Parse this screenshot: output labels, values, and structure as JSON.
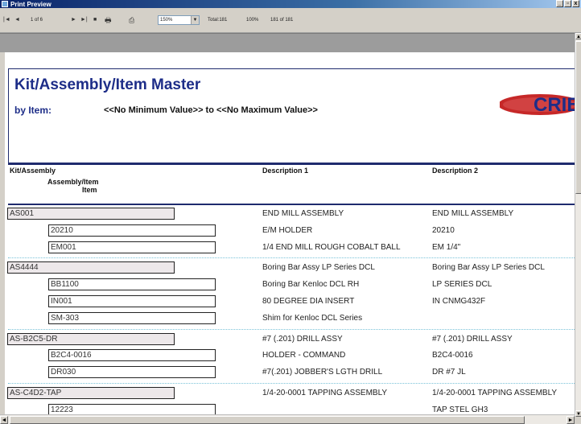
{
  "window": {
    "title": "Print Preview",
    "minimize": "_",
    "maximize": "▫",
    "close": "x"
  },
  "toolbar": {
    "first_page": "|◄",
    "prev_page": "◄",
    "page_indicator": "1 of 6",
    "next_page": "►",
    "last_page": "►|",
    "stop": "■",
    "print": "🖶",
    "export": "⎙",
    "zoom": "150%",
    "zoom_dropdown": "▼",
    "total": "Total:181",
    "percent": "100%",
    "records": "181 of 181"
  },
  "report": {
    "title": "Kit/Assembly/Item Master",
    "by_label": "by Item:",
    "range_text": "<<No Minimum Value>>  to  <<No Maximum Value>>",
    "logo_text": "CRIB",
    "col_kit": "Kit/Assembly",
    "col_assembly_item": "Assembly/Item",
    "col_item": "Item",
    "col_desc1": "Description 1",
    "col_desc2": "Description 2",
    "kits": [
      {
        "code": "AS001",
        "desc1": "END MILL ASSEMBLY",
        "desc2": "END MILL ASSEMBLY",
        "items": [
          {
            "code": "20210",
            "desc1": "E/M HOLDER",
            "desc2": "20210"
          },
          {
            "code": "EM001",
            "desc1": "1/4 END MILL ROUGH COBALT BALL",
            "desc2": "EM 1/4\""
          }
        ]
      },
      {
        "code": "AS4444",
        "desc1": "Boring Bar Assy  LP Series DCL",
        "desc2": "Boring Bar Assy  LP Series DCL",
        "items": [
          {
            "code": "BB1100",
            "desc1": "Boring Bar Kenloc DCL RH",
            "desc2": "LP SERIES DCL"
          },
          {
            "code": "IN001",
            "desc1": "80 DEGREE DIA INSERT",
            "desc2": "IN CNMG432F"
          },
          {
            "code": "SM-303",
            "desc1": "Shim for Kenloc DCL Series",
            "desc2": ""
          }
        ]
      },
      {
        "code": "AS-B2C5-DR",
        "desc1": "#7 (.201) DRILL ASSY",
        "desc2": "#7 (.201) DRILL ASSY",
        "items": [
          {
            "code": "B2C4-0016",
            "desc1": "HOLDER - COMMAND",
            "desc2": "B2C4-0016"
          },
          {
            "code": "DR030",
            "desc1": "#7(.201) JOBBER'S LGTH DRILL",
            "desc2": "DR #7 JL"
          }
        ]
      },
      {
        "code": "AS-C4D2-TAP",
        "desc1": "1/4-20-0001 TAPPING ASSEMBLY",
        "desc2": "1/4-20-0001 TAPPING ASSEMBLY",
        "items": [
          {
            "code": "12223",
            "desc1": "",
            "desc2": "TAP STEL GH3"
          }
        ]
      }
    ]
  },
  "colors": {
    "title_blue": "#1d2d88",
    "logo_red": "#c62828",
    "kit_box_fill": "#ede8ea",
    "separator": "#79c2d9"
  }
}
